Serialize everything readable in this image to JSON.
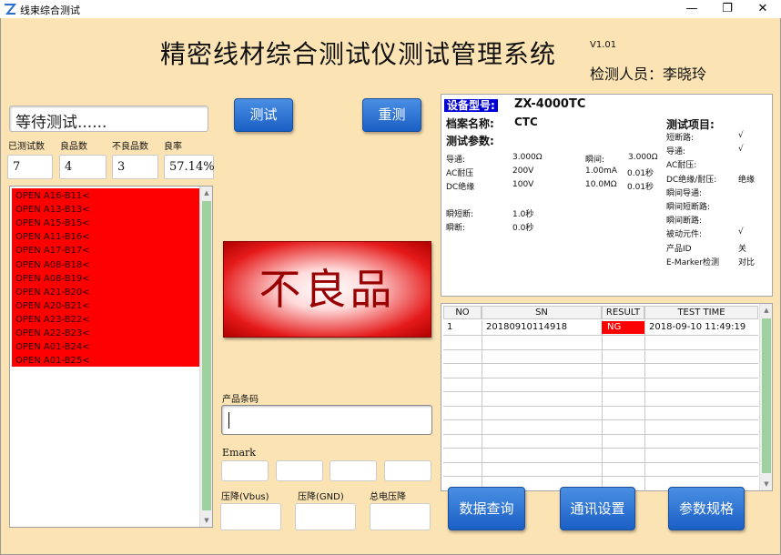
{
  "window": {
    "title": "线束综合测试",
    "minimize": "—",
    "maximize": "❐",
    "close": "✕"
  },
  "header": {
    "title": "精密线材综合测试仪测试管理系统",
    "version": "V1.01",
    "inspector": "检测人员：李晓玲"
  },
  "status": "等待测试......",
  "stats": {
    "tested_label": "已测试数",
    "tested": "7",
    "good_label": "良品数",
    "good": "4",
    "bad_label": "不良品数",
    "bad": "3",
    "rate_label": "良率",
    "rate": "57.14%"
  },
  "log": [
    "OPEN   A16-B11<",
    "OPEN   A13-B13<",
    "OPEN   A15-B15<",
    "OPEN   A11-B16<",
    "OPEN   A17-B17<",
    "OPEN   A08-B18<",
    "OPEN   A08-B19<",
    "OPEN   A21-B20<",
    "OPEN   A20-B21<",
    "OPEN   A23-B22<",
    "OPEN   A22-B23<",
    "OPEN   A01-B24<",
    "OPEN   A01-B25<"
  ],
  "buttons": {
    "test": "测试",
    "retest": "重测",
    "query": "数据查询",
    "comm": "通讯设置",
    "params": "参数规格"
  },
  "result": "不良品",
  "barcode_label": "产品条码",
  "emark_label": "Emark",
  "vbus_label": "压降(Vbus)",
  "gnd_label": "压降(GND)",
  "total_label": "总电压降",
  "info": {
    "model_label": "设备型号:",
    "model": "ZX-4000TC",
    "file_label": "档案名称:",
    "file": "CTC",
    "params_label": "测试参数:",
    "items_label": "测试项目:",
    "conduct": "导通:",
    "conduct_v": "3.000Ω",
    "instant": "瞬间:",
    "instant_v": "3.000Ω",
    "ac": "AC耐压",
    "ac_v": "200V",
    "ac_i": "1.00mA",
    "ac_t": "0.01秒",
    "dc": "DC绝缘",
    "dc_v": "100V",
    "dc_r": "10.0MΩ",
    "dc_t": "0.01秒",
    "ishort": "瞬短断:",
    "ishort_v": "1.0秒",
    "ibreak": "瞬断:",
    "ibreak_v": "0.0秒",
    "items": [
      {
        "name": "短断路:",
        "val": "√"
      },
      {
        "name": "导通:",
        "val": "√"
      },
      {
        "name": "AC耐压:",
        "val": ""
      },
      {
        "name": "DC绝缘/耐压:",
        "val": "绝缘"
      },
      {
        "name": "瞬间导通:",
        "val": ""
      },
      {
        "name": "瞬间短断路:",
        "val": ""
      },
      {
        "name": "瞬间断路:",
        "val": ""
      },
      {
        "name": "被动元件:",
        "val": "√"
      },
      {
        "name": "产品ID",
        "val": "关"
      },
      {
        "name": "E-Marker检测",
        "val": "对比"
      }
    ]
  },
  "grid": {
    "headers": [
      "NO",
      "SN",
      "RESULT",
      "TEST TIME"
    ],
    "rows": [
      {
        "no": "1",
        "sn": "20180910114918",
        "result": "NG",
        "time": "2018-09-10 11:49:19"
      }
    ]
  }
}
